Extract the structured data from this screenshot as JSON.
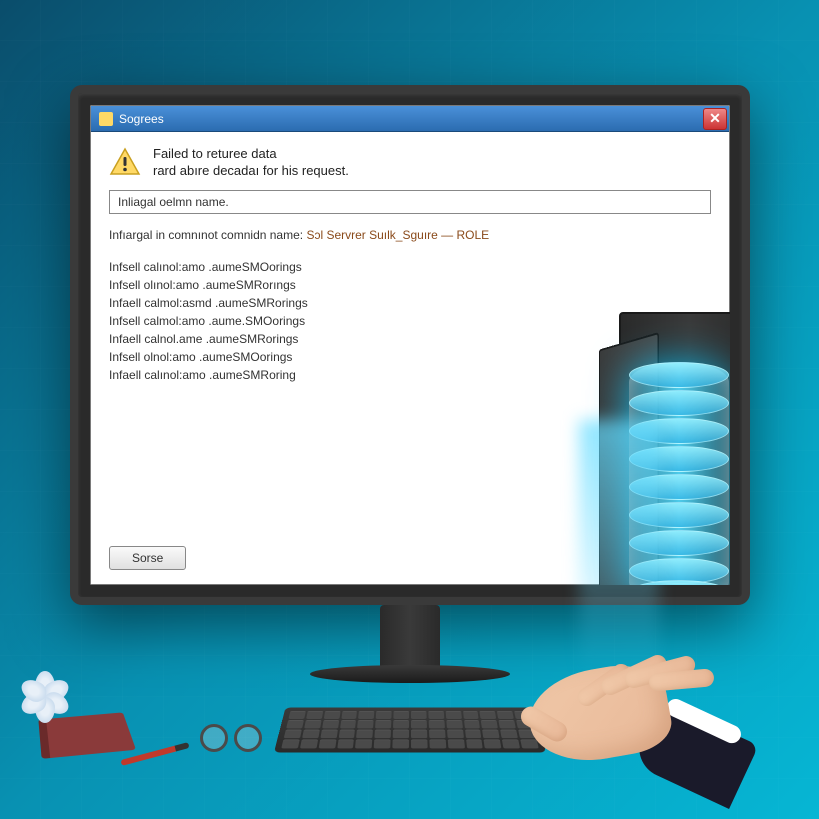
{
  "dialog": {
    "title": "Sogrees",
    "close_label": "✕",
    "error_line1": "Failed to returee data",
    "error_line2": "rard abıre decadaı for his request.",
    "field_label": "Inliagal oelmn name.",
    "detail_prefix": "Infıargal in comnınot comnidn name:",
    "detail_sql": "Sɔl Servrer Suılk_Sguıre — ROLE",
    "error_items": [
      "Infsell calınol:amo .aumeSMOorings",
      "Infsell olınol:amo .aumeSMRorıngs",
      "Infaell calmol:asmd .aumeSMRorings",
      "Infsell calmol:amo .aume.SMOorings",
      "Infaell calnol.ame .aumeSMRorings",
      "Infsell olnol:amo .aumeSMOorings",
      "Infaell calınol:amo .aumeSMRoring"
    ],
    "button_label": "Sorse"
  }
}
